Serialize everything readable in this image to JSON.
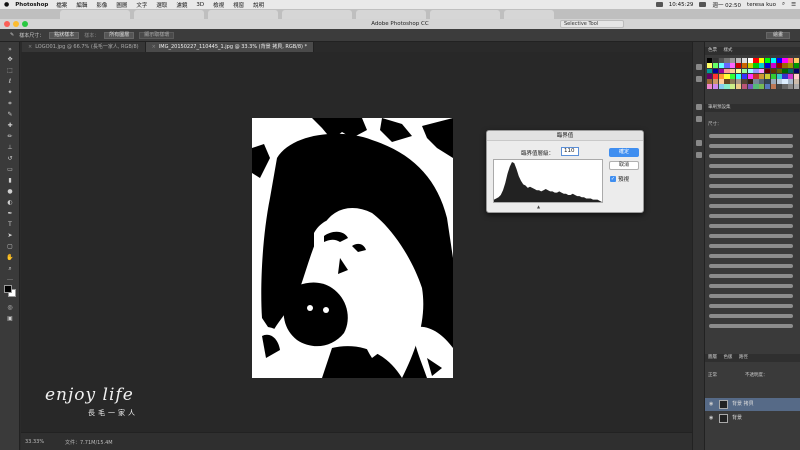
{
  "menubar": {
    "apple": "",
    "app": "Photoshop",
    "menus": [
      "檔案",
      "編輯",
      "影像",
      "圖層",
      "文字",
      "選取",
      "濾鏡",
      "3D",
      "檢視",
      "視窗",
      "說明"
    ],
    "clock": "週一 02:50",
    "time_left": "10:45:29",
    "user": "teresa kuo"
  },
  "ps_title": "Adobe Photoshop CC",
  "selective_tool": "Selective Tool",
  "options": {
    "preset_label": "樣本尺寸：",
    "preset_value": "點狀樣本",
    "sample_label": "樣本：",
    "sample_value": "所有圖層",
    "sample_ring": "顯示取樣環",
    "workspace": "繪畫"
  },
  "doctabs": [
    {
      "label": "LOGO01.jpg @ 66.7% (長毛一家人, RGB/8)",
      "active": false
    },
    {
      "label": "IMG_20150227_110445_1.jpg @ 33.3% (背景 拷貝, RGB/8) *",
      "active": true
    }
  ],
  "status": {
    "zoom": "33.33%",
    "doc": "文件：7.71M/15.4M"
  },
  "watermark": {
    "main": "enjoy life",
    "sub": "長毛一家人"
  },
  "dialog": {
    "title": "臨界值",
    "field_label": "臨界值層級：",
    "field_value": "110",
    "ok": "確定",
    "cancel": "取消",
    "preview": "預視",
    "preview_checked": true,
    "hist_marker": "▲"
  },
  "panels": {
    "swatch_tabs": [
      "色票",
      "樣式"
    ],
    "brush_tabs": [
      "筆刷預設集"
    ],
    "brush_size_label": "尺寸：",
    "layer_tabs": [
      "圖層",
      "色版",
      "路徑"
    ],
    "layer_mode": "正常",
    "layer_opacity": "不透明度：",
    "layers": [
      {
        "name": "背景 拷貝",
        "selected": true
      },
      {
        "name": "背景",
        "selected": false
      }
    ]
  },
  "colors": {
    "accent": "#3f8ef0",
    "canvas_bg": "#282828",
    "panel_bg": "#3a3a3a"
  },
  "histogram_values": [
    2,
    3,
    4,
    6,
    10,
    16,
    24,
    30,
    34,
    33,
    28,
    22,
    18,
    15,
    14,
    12,
    13,
    12,
    11,
    10,
    10,
    9,
    10,
    11,
    10,
    9,
    9,
    8,
    8,
    9,
    8,
    7,
    7,
    6,
    6,
    7,
    6,
    5,
    5,
    4,
    4,
    3,
    3,
    3,
    2,
    2,
    2,
    1
  ]
}
